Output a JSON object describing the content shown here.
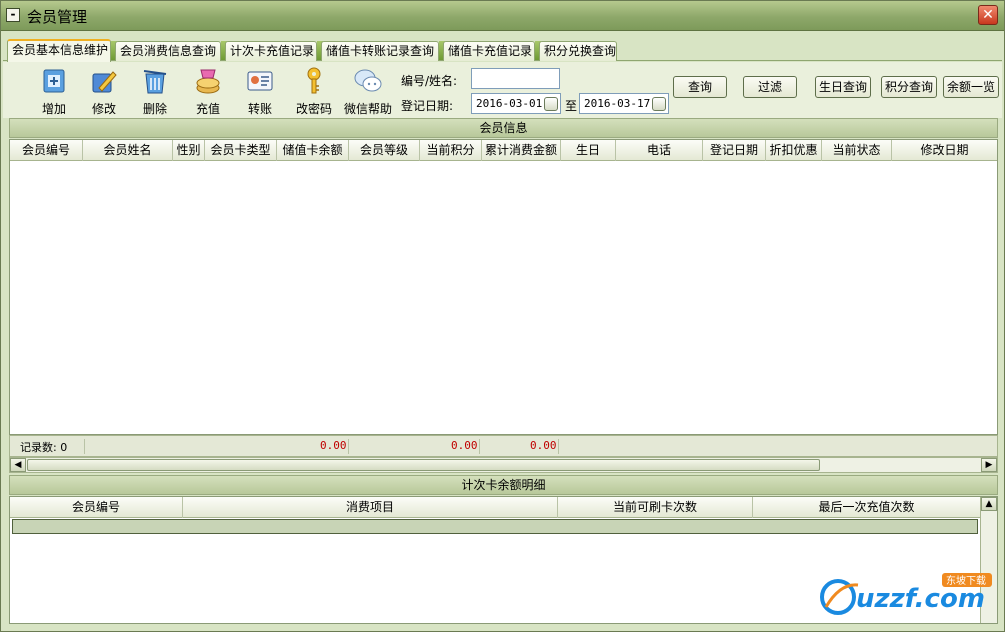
{
  "window": {
    "title": "会员管理",
    "close_icon": "close-icon"
  },
  "tabs": [
    {
      "label": "会员基本信息维护",
      "active": true
    },
    {
      "label": "会员消费信息查询",
      "active": false
    },
    {
      "label": "计次卡充值记录",
      "active": false
    },
    {
      "label": "储值卡转账记录查询",
      "active": false
    },
    {
      "label": "储值卡充值记录",
      "active": false
    },
    {
      "label": "积分兑换查询",
      "active": false
    }
  ],
  "toolbar": {
    "tools": [
      {
        "label": "增加",
        "icon": "add-card-icon"
      },
      {
        "label": "修改",
        "icon": "edit-icon"
      },
      {
        "label": "删除",
        "icon": "delete-icon"
      },
      {
        "label": "充值",
        "icon": "recharge-icon"
      },
      {
        "label": "转账",
        "icon": "transfer-icon"
      },
      {
        "label": "改密码",
        "icon": "key-icon"
      },
      {
        "label": "微信帮助",
        "icon": "wechat-icon"
      }
    ],
    "search_label": "编号/姓名:",
    "search_value": "",
    "date_label": "登记日期:",
    "date_from": "2016-03-01",
    "date_to_label": "至",
    "date_to": "2016-03-17",
    "query_label": "查询",
    "filter_label": "过滤",
    "birthday_label": "生日查询",
    "points_label": "积分查询",
    "balance_label": "余额一览"
  },
  "member_grid": {
    "title": "会员信息",
    "columns": [
      "会员编号",
      "会员姓名",
      "性别",
      "会员卡类型",
      "储值卡余额",
      "会员等级",
      "当前积分",
      "累计消费金额",
      "生日",
      "电话",
      "登记日期",
      "折扣优惠",
      "当前状态",
      "修改日期"
    ],
    "rows": [],
    "footer": {
      "record_label": "记录数: 0",
      "balance_total": "0.00",
      "points_total": "0.00",
      "consumption_total": "0.00"
    }
  },
  "count_card_grid": {
    "title": "计次卡余额明细",
    "columns": [
      "会员编号",
      "消费项目",
      "当前可刷卡次数",
      "最后一次充值次数"
    ]
  },
  "watermark": {
    "brand": "uzzf.com",
    "sub": "东坡下载"
  },
  "colors": {
    "accent_tab": "#f0b020",
    "window_bg": "#d8e4c4",
    "footer_value": "#c00000"
  }
}
